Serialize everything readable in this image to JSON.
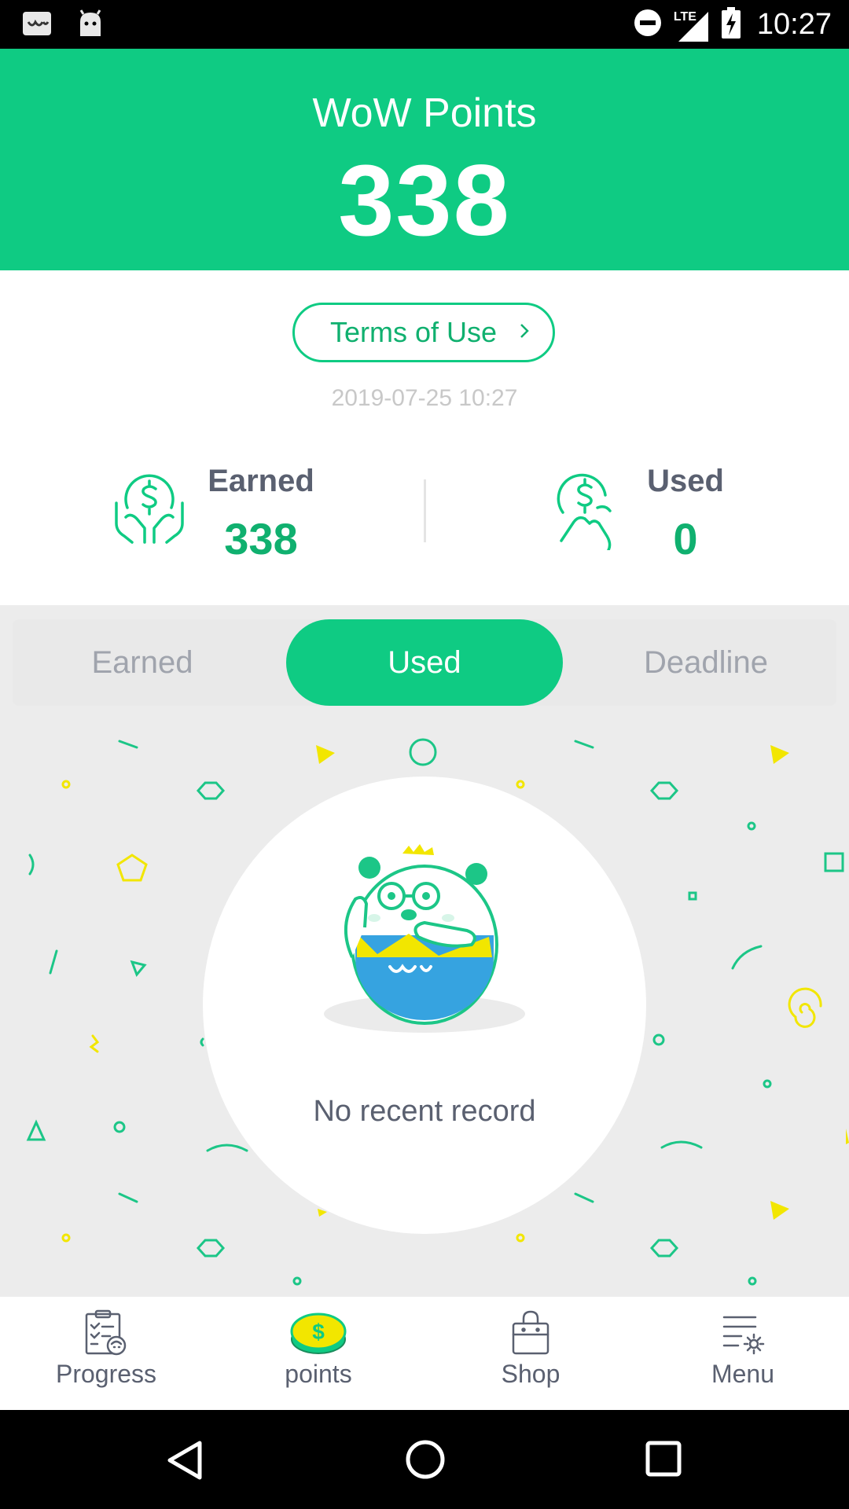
{
  "status_bar": {
    "time": "10:27",
    "network": "LTE",
    "left_icons": [
      "wow-app-icon",
      "android-icon"
    ],
    "right_icons": [
      "do-not-disturb-icon",
      "signal-icon",
      "battery-charging-icon"
    ]
  },
  "header": {
    "title": "WoW Points",
    "points": "338",
    "color": "#0fcb83"
  },
  "terms": {
    "label": "Terms of Use",
    "icon": "chevron-right-icon"
  },
  "timestamp": "2019-07-25 10:27",
  "summary": {
    "earned": {
      "label": "Earned",
      "value": "338",
      "icon": "hands-dollar-icon"
    },
    "used": {
      "label": "Used",
      "value": "0",
      "icon": "hand-dollar-icon"
    }
  },
  "tabs": [
    {
      "label": "Earned",
      "active": false
    },
    {
      "label": "Used",
      "active": true
    },
    {
      "label": "Deadline",
      "active": false
    }
  ],
  "empty_state": {
    "message": "No recent record",
    "icon": "bear-mascot-icon"
  },
  "bottom_nav": [
    {
      "label": "Progress",
      "icon": "clipboard-icon",
      "active": false
    },
    {
      "label": "points",
      "icon": "coin-icon",
      "active": true
    },
    {
      "label": "Shop",
      "icon": "shopping-bag-icon",
      "active": false
    },
    {
      "label": "Menu",
      "icon": "menu-settings-icon",
      "active": false
    }
  ],
  "system_nav": [
    "back-icon",
    "home-icon",
    "recents-icon"
  ]
}
